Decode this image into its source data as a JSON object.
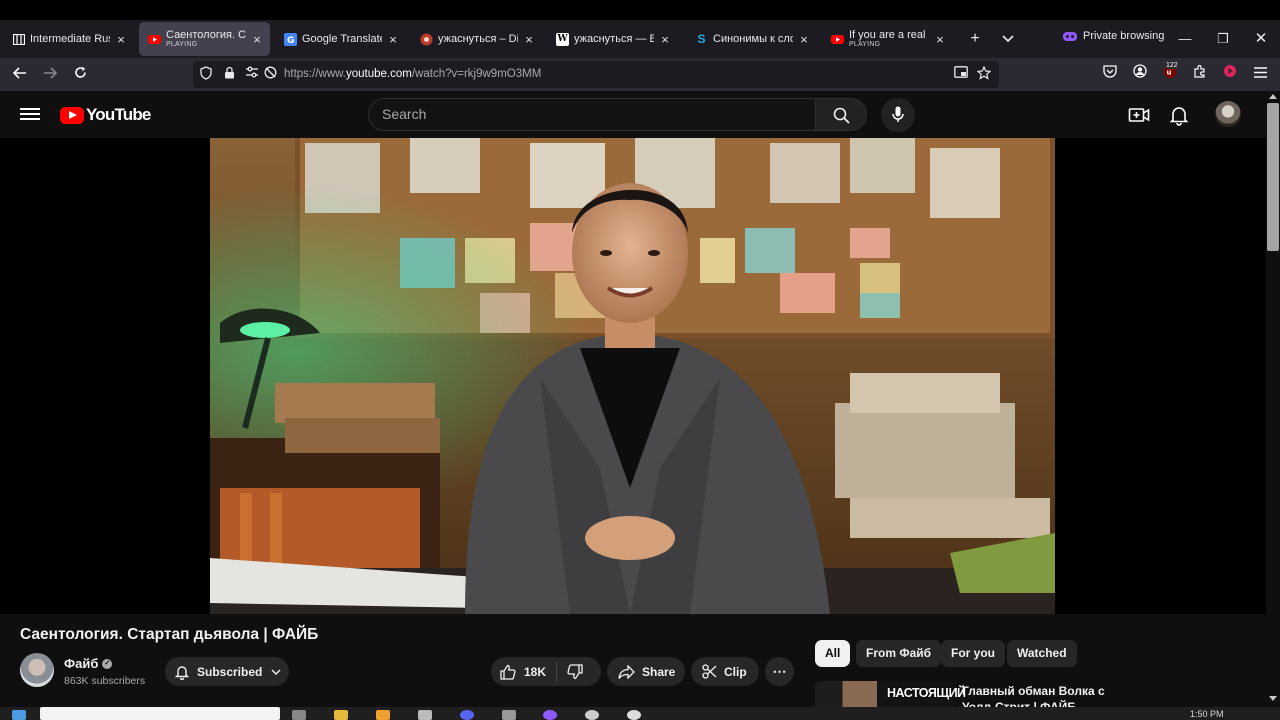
{
  "browser": {
    "tabs": [
      {
        "label": "Intermediate Russia",
        "sub": "",
        "favicon": "book-icon",
        "active": false
      },
      {
        "label": "Саентология. Старт",
        "sub": "PLAYING",
        "favicon": "youtube-icon",
        "active": true
      },
      {
        "label": "Google Translate",
        "sub": "",
        "favicon": "google-translate-icon",
        "active": false
      },
      {
        "label": "ужаснуться – Dictio",
        "sub": "",
        "favicon": "dictionary-icon",
        "active": false
      },
      {
        "label": "ужаснуться — Вики",
        "sub": "",
        "favicon": "wikipedia-icon",
        "active": false
      },
      {
        "label": "Синонимы к слову",
        "sub": "",
        "favicon": "synonyms-icon",
        "active": false
      },
      {
        "label": "If you are a real doc",
        "sub": "PLAYING",
        "favicon": "youtube-icon",
        "active": false
      }
    ],
    "private_label": "Private browsing",
    "url_prefix": "https://www.",
    "url_domain": "youtube.com",
    "url_path": "/watch?v=rkj9w9mO3MM",
    "extension_badge": "122"
  },
  "youtube": {
    "brand": "YouTube",
    "search_placeholder": "Search",
    "video_title": "Саентология. Стартап дьявола | ФАЙБ",
    "channel": {
      "name": "Файб",
      "subscribers": "863K subscribers"
    },
    "subscribed_label": "Subscribed",
    "like_count": "18K",
    "share_label": "Share",
    "clip_label": "Clip",
    "chips": [
      "All",
      "From Файб",
      "For you",
      "Watched"
    ],
    "recommended": {
      "thumb_text": "НАСТОЯЩИЙ",
      "title": "Главный обман Волка с Уолл-Стрит | ФАЙБ"
    }
  },
  "taskbar": {
    "clock": "1:50 PM"
  },
  "colors": {
    "accent": "#ff0000",
    "private": "#9059ff",
    "bg": "#0f0f0f"
  }
}
